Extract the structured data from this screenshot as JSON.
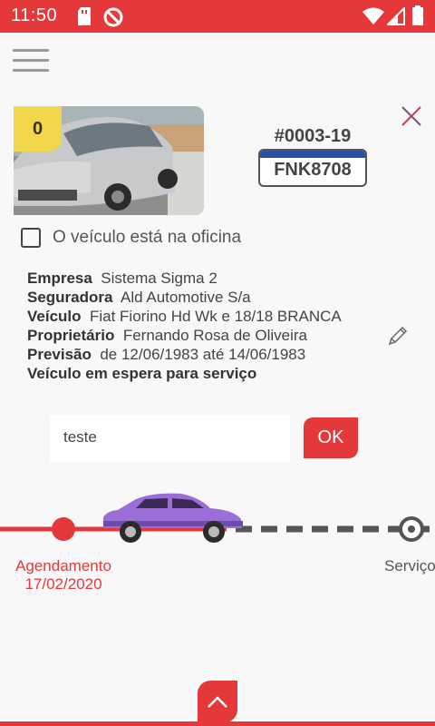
{
  "status_bar": {
    "time": "11:50",
    "icons": [
      "sd-card-icon",
      "sync-blocked-icon",
      "wifi-icon",
      "signal-icon",
      "battery-icon"
    ]
  },
  "colors": {
    "accent": "#e5383b",
    "badge": "#f3d74a",
    "car": "#9a6ed6",
    "plate_bar": "#2a52a0"
  },
  "vehicle": {
    "counter": "0",
    "order_number": "#0003-19",
    "plate": "FNK8708",
    "in_shop_label": "O veículo está na oficina",
    "in_shop_checked": false
  },
  "details": {
    "empresa_label": "Empresa",
    "empresa_value": "Sistema Sigma 2",
    "seguradora_label": "Seguradora",
    "seguradora_value": "Ald Automotive S/a",
    "veiculo_label": "Veículo",
    "veiculo_value": "Fiat Fiorino Hd Wk e 18/18 BRANCA",
    "proprietario_label": "Proprietário",
    "proprietario_value": "Fernando Rosa de Oliveira",
    "previsao_label": "Previsão",
    "previsao_value": "de 12/06/1983 até 14/06/1983",
    "status": "Veículo em espera para serviço"
  },
  "note": {
    "value": "teste",
    "ok_label": "OK"
  },
  "timeline": {
    "steps": [
      {
        "label": "Agendamento",
        "date": "17/02/2020"
      },
      {
        "label": "Serviço",
        "date": ""
      }
    ]
  }
}
